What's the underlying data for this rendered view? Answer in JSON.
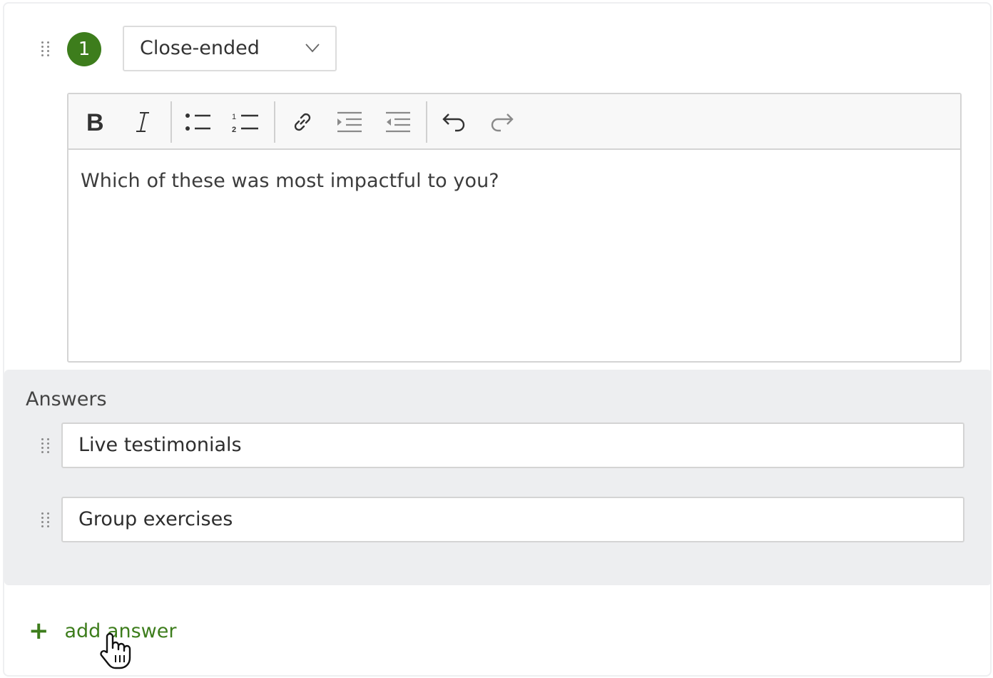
{
  "question": {
    "number": "1",
    "type_selected": "Close-ended",
    "text": "Which of these was most impactful to you?"
  },
  "toolbar": {
    "buttons": [
      "bold-icon",
      "italic-icon",
      "bulleted-list-icon",
      "numbered-list-icon",
      "link-icon",
      "indent-icon",
      "outdent-icon",
      "undo-icon",
      "redo-icon"
    ]
  },
  "answers": {
    "label": "Answers",
    "items": [
      {
        "value": "Live testimonials"
      },
      {
        "value": "Group exercises"
      }
    ]
  },
  "add_answer": {
    "icon": "plus-icon",
    "label": "add answer"
  },
  "colors": {
    "accent": "#3d7d1c",
    "panel_bg": "#edeef0",
    "border": "#d4d4d4"
  }
}
